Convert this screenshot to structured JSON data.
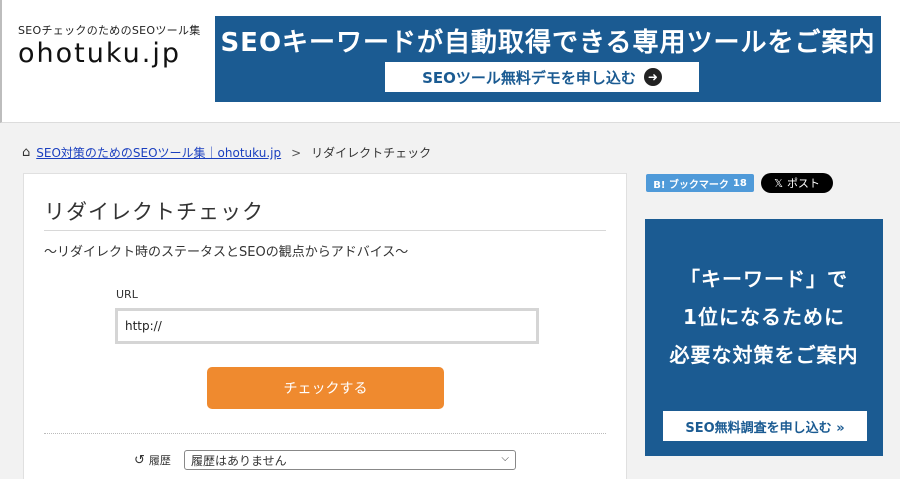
{
  "header": {
    "tagline": "SEOチェックのためのSEOツール集",
    "logo": "ohotuku.jp",
    "banner": {
      "title": "SEOキーワードが自動取得できる専用ツールをご案内",
      "button_label": "SEOツール無料デモを申し込む",
      "button_icon": "arrow-right-circle-icon"
    }
  },
  "breadcrumb": {
    "home_link": "SEO対策のためのSEOツール集｜ohotuku.jp",
    "separator": ">",
    "current": "リダイレクトチェック"
  },
  "main": {
    "title": "リダイレクトチェック",
    "subtitle": "～リダイレクト時のステータスとSEOの観点からアドバイス～",
    "url_label": "URL",
    "url_value": "http://",
    "check_button": "チェックする",
    "history_label": "履歴",
    "history_selected": "履歴はありません"
  },
  "social": {
    "bookmark_label": "B! ブックマーク",
    "bookmark_count": "18",
    "x_label": "ポスト"
  },
  "side_banner": {
    "line1": "「キーワード」で",
    "line2": "1位になるために",
    "line3": "必要な対策をご案内",
    "button_label": "SEO無料調査を申し込む »"
  },
  "colors": {
    "brand_blue": "#1b5b92",
    "button_orange": "#ef8a2f",
    "link_blue": "#1a3fbf",
    "bookmark_blue": "#4f9ad9"
  }
}
